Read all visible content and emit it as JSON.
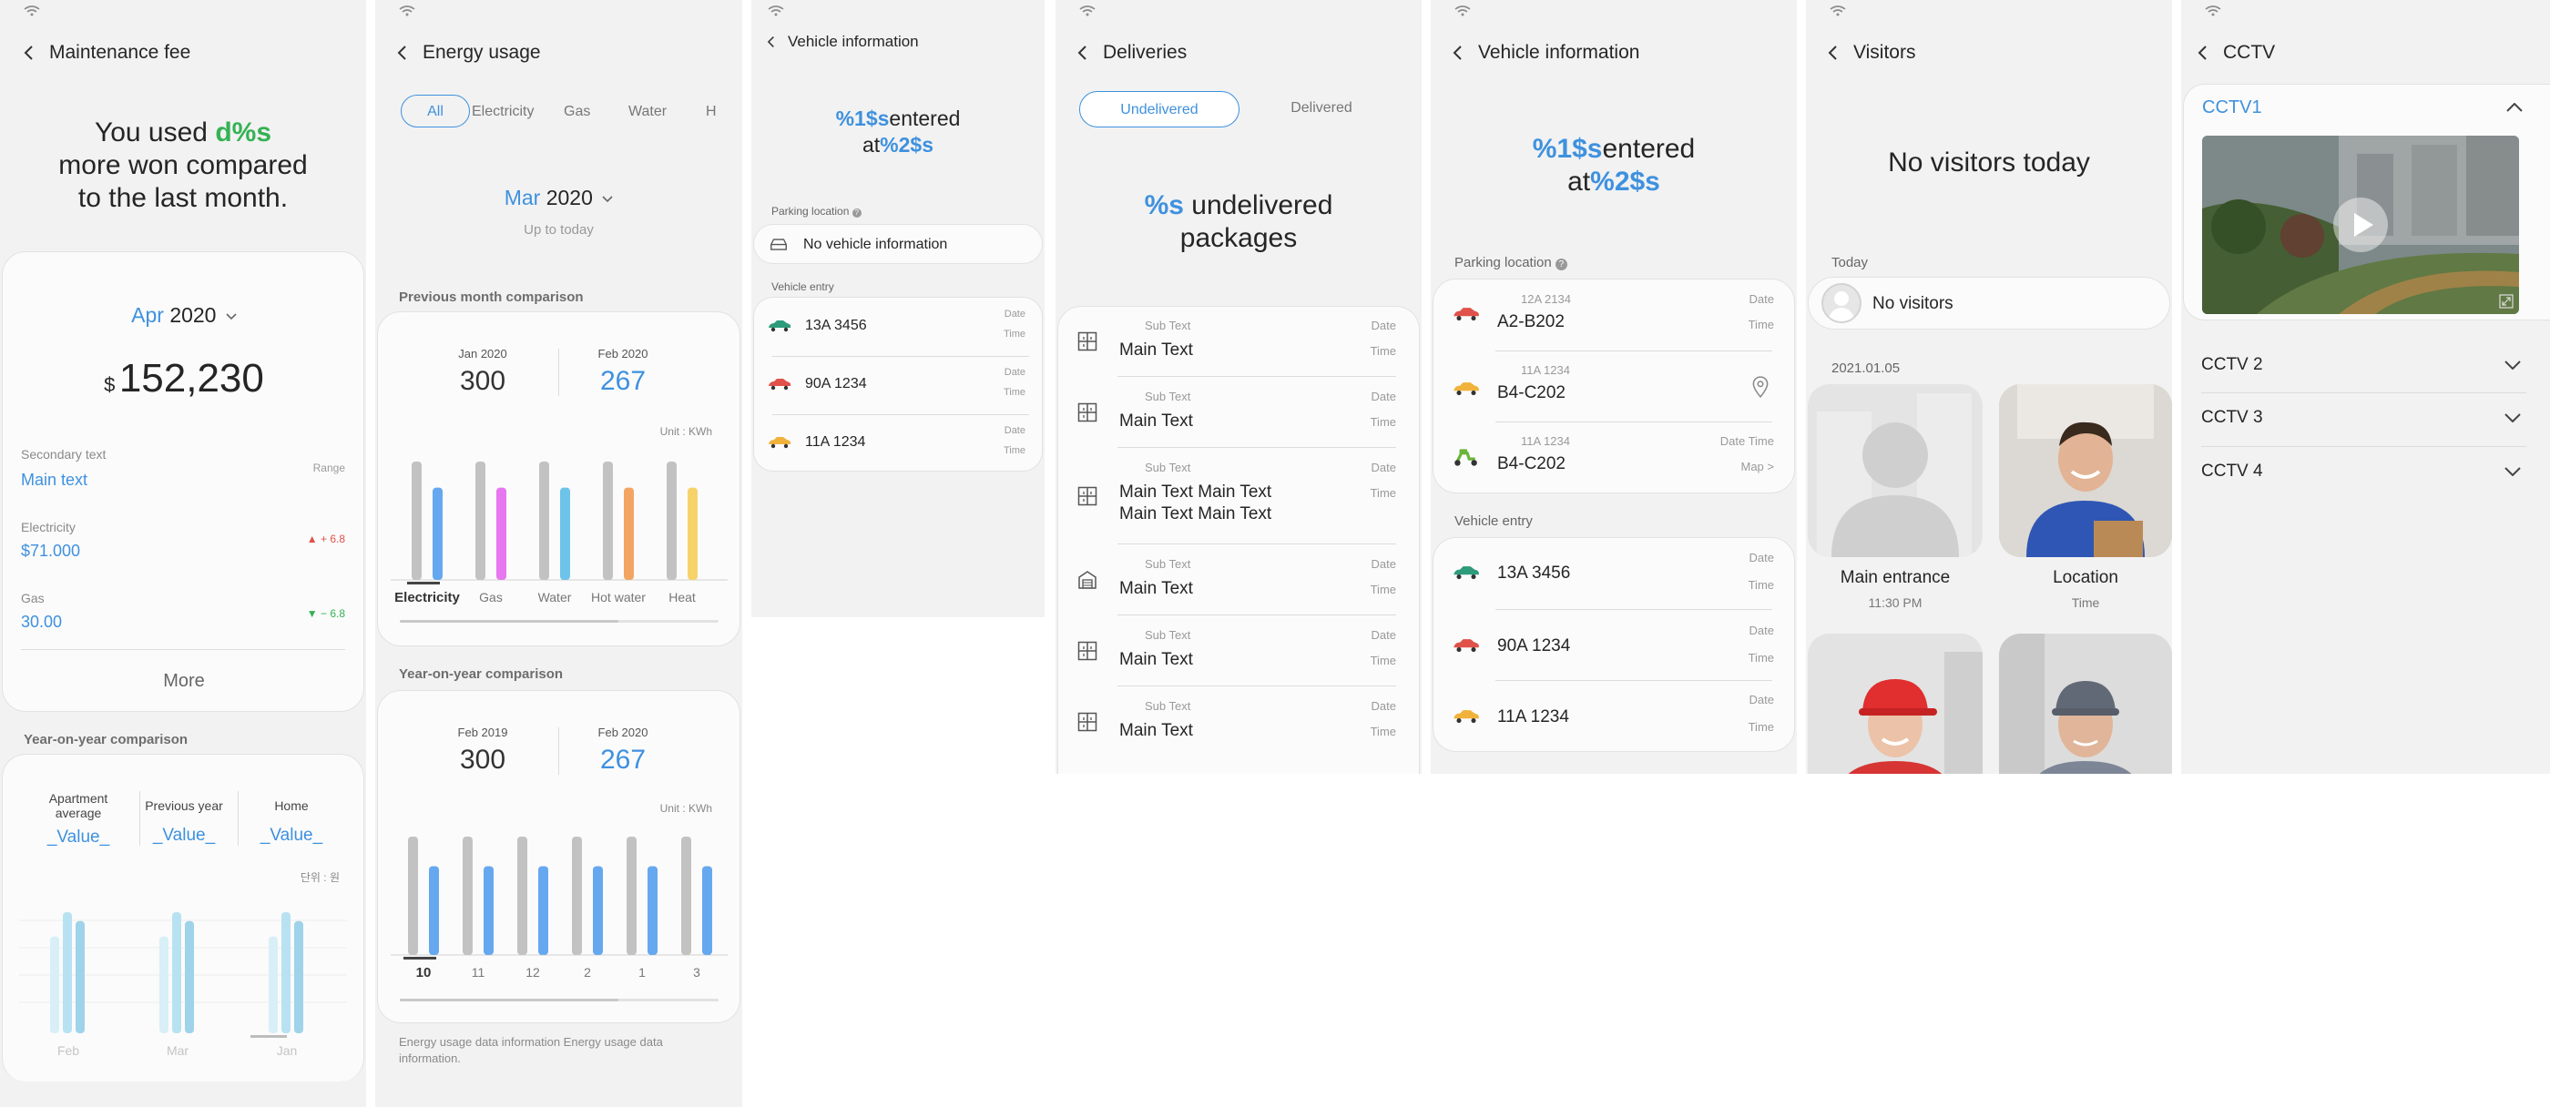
{
  "colors": {
    "accent": "#3e91df",
    "green": "#35b254",
    "red": "#e0524a",
    "bg": "#f2f2f2",
    "card": "#fbfbfb"
  },
  "p1": {
    "title": "Maintenance fee",
    "summary": {
      "pre": "You used ",
      "value": "d%s",
      "line2": "more won compared",
      "line3": "to the last month."
    },
    "month": "Apr",
    "year": "2020",
    "currency": "$",
    "amount": "152,230",
    "secondary_text": "Secondary text",
    "main_text": "Main text",
    "range": "Range",
    "items": [
      {
        "label": "Electricity",
        "value": "$71.000",
        "change": "6.8",
        "trend": "up"
      },
      {
        "label": "Gas",
        "value": "30.00",
        "change": "6.8",
        "trend": "down"
      }
    ],
    "more": "More",
    "yoy_title": "Year-on-year comparison",
    "yoy_cols": [
      {
        "label": "Apartment average",
        "value": "_Value_"
      },
      {
        "label": "Previous year",
        "value": "_Value_"
      },
      {
        "label": "Home",
        "value": "_Value_"
      }
    ],
    "unit": "단위 : 원"
  },
  "p2": {
    "title": "Energy usage",
    "tabs": [
      "All",
      "Electricity",
      "Gas",
      "Water",
      "H"
    ],
    "month": "Mar",
    "year": "2020",
    "up_to": "Up to today",
    "prev_title": "Previous month comparison",
    "prev": {
      "left_label": "Jan 2020",
      "left_value": "300",
      "right_label": "Feb 2020",
      "right_value": "267"
    },
    "unit": "Unit : KWh",
    "yoy_title": "Year-on-year comparison",
    "yoy": {
      "left_label": "Feb 2019",
      "left_value": "300",
      "right_label": "Feb 2020",
      "right_value": "267"
    },
    "footnote": "Energy usage data information Energy usage data information."
  },
  "chart_data": [
    {
      "type": "bar",
      "categories": [
        "Electricity",
        "Gas",
        "Water",
        "Hot water",
        "Heat"
      ],
      "series": [
        {
          "values": [
            100,
            100,
            100,
            100,
            100
          ],
          "color": "#c2c2c2"
        },
        {
          "values": [
            78,
            78,
            78,
            78,
            78
          ],
          "colors": [
            "#66a8ef",
            "#e777ee",
            "#6ec3ea",
            "#f4a462",
            "#f6d36a"
          ]
        }
      ],
      "unit": "Unit : KWh"
    },
    {
      "type": "bar",
      "categories": [
        "10",
        "11",
        "12",
        "2",
        "1",
        "3"
      ],
      "series": [
        {
          "values": [
            100,
            100,
            100,
            100,
            100,
            100
          ],
          "color": "#c2c2c2"
        },
        {
          "values": [
            75,
            75,
            75,
            75,
            75,
            75
          ],
          "color": "#66a8ef"
        }
      ],
      "unit": "Unit : KWh"
    },
    {
      "type": "bar",
      "categories": [
        "Feb",
        "Mar",
        "Jan"
      ],
      "series": [
        {
          "values": [
            76,
            76,
            76
          ]
        },
        {
          "values": [
            95,
            95,
            95
          ]
        },
        {
          "values": [
            88,
            88,
            88
          ]
        }
      ],
      "unit": "단위 : 원"
    }
  ],
  "p3": {
    "title": "Vehicle information",
    "entered": {
      "v1": "%1$s",
      "t1": "entered",
      "t2": "at",
      "v2": "%2$s"
    },
    "parking_label": "Parking location",
    "no_vehicle": "No vehicle information",
    "entry_label": "Vehicle entry",
    "entries": [
      {
        "plate": "13A 3456",
        "date": "Date",
        "time": "Time",
        "car": "#2e9b7a"
      },
      {
        "plate": "90A 1234",
        "date": "Date",
        "time": "Time",
        "car": "#e0524a"
      },
      {
        "plate": "11A 1234",
        "date": "Date",
        "time": "Time",
        "car": "#f0b23a"
      }
    ]
  },
  "p4": {
    "title": "Deliveries",
    "tab_active": "Undelivered",
    "tab_other": "Delivered",
    "count": "%s",
    "count_text": "undelivered",
    "count_line2": "packages",
    "items": [
      {
        "sub": "Sub Text",
        "main": "Main Text",
        "date": "Date",
        "time": "Time",
        "icon": "locker-icon"
      },
      {
        "sub": "Sub Text",
        "main": "Main Text",
        "date": "Date",
        "time": "Time",
        "icon": "locker-icon"
      },
      {
        "sub": "Sub Text",
        "main": "Main Text Main Text",
        "main2": "Main Text Main Text",
        "date": "Date",
        "time": "Time",
        "icon": "locker-icon"
      },
      {
        "sub": "Sub Text",
        "main": "Main Text",
        "date": "Date",
        "time": "Time",
        "icon": "office-icon"
      },
      {
        "sub": "Sub Text",
        "main": "Main Text",
        "date": "Date",
        "time": "Time",
        "icon": "locker-icon"
      },
      {
        "sub": "Sub Text",
        "main": "Main Text",
        "date": "Date",
        "time": "Time",
        "icon": "locker-icon"
      }
    ]
  },
  "p5": {
    "title": "Vehicle information",
    "entered": {
      "v1": "%1$s",
      "t1": "entered",
      "t2": "at",
      "v2": "%2$s"
    },
    "parking_label": "Parking location",
    "parking": [
      {
        "plate": "12A 2134",
        "loc": "A2-B202",
        "right1": "Date",
        "right2": "Time",
        "vehicle": "car",
        "color": "#e0524a"
      },
      {
        "plate": "11A 1234",
        "loc": "B4-C202",
        "right1": "",
        "right2": "",
        "vehicle": "car",
        "color": "#f0b23a"
      },
      {
        "plate": "11A 1234",
        "loc": "B4-C202",
        "right1": "Date Time",
        "right2": "Map >",
        "vehicle": "scooter",
        "color": "#6bb43a"
      }
    ],
    "entry_label": "Vehicle entry",
    "entries": [
      {
        "plate": "13A 3456",
        "date": "Date",
        "time": "Time",
        "car": "#2e9b7a"
      },
      {
        "plate": "90A 1234",
        "date": "Date",
        "time": "Time",
        "car": "#e0524a"
      },
      {
        "plate": "11A 1234",
        "date": "Date",
        "time": "Time",
        "car": "#f0b23a"
      }
    ]
  },
  "p6": {
    "title": "Visitors",
    "empty": "No visitors today",
    "today": "Today",
    "no_visitors": "No visitors",
    "date": "2021.01.05",
    "cards": [
      {
        "name": "Main entrance",
        "sub": "11:30 PM"
      },
      {
        "name": "Location",
        "sub": "Time"
      }
    ]
  },
  "p7": {
    "title": "CCTV",
    "items": [
      "CCTV1",
      "CCTV 2",
      "CCTV 3",
      "CCTV 4"
    ]
  }
}
